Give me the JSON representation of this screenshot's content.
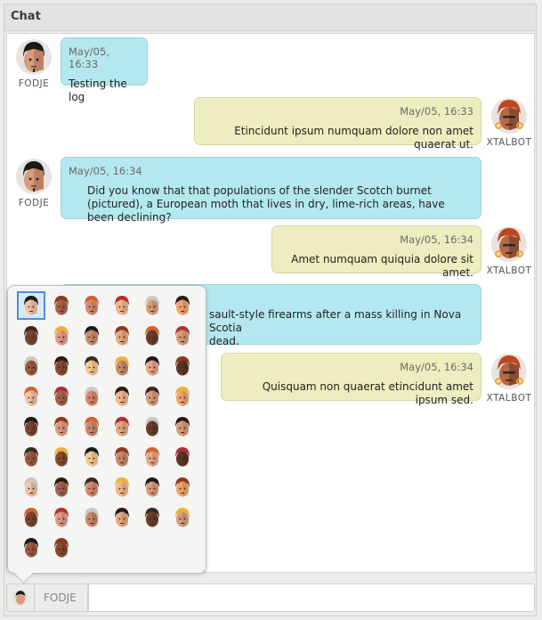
{
  "window": {
    "title": "Chat"
  },
  "messages": [
    {
      "side": "left",
      "user": "FODJE",
      "time": "May/05, 16:33",
      "text": "Testing the log"
    },
    {
      "side": "right",
      "user": "XTALBOT",
      "time": "May/05, 16:33",
      "text": "Etincidunt ipsum numquam dolore non amet quaerat ut."
    },
    {
      "side": "left",
      "user": "FODJE",
      "time": "May/05, 16:34",
      "text": "Did you know that that populations of the slender Scotch burnet (pictured), a European moth that lives in dry, lime-rich areas, have been declining?"
    },
    {
      "side": "right",
      "user": "XTALBOT",
      "time": "May/05, 16:34",
      "text": "Amet numquam quiquia dolore sit amet."
    },
    {
      "side": "left",
      "user": "FODJE",
      "time": "",
      "text": "sault-style firearms after a mass killing in Nova Scotia",
      "text2": "dead."
    },
    {
      "side": "right",
      "user": "XTALBOT",
      "time": "May/05, 16:34",
      "text": "Quisquam non quaerat etincidunt amet ipsum sed."
    }
  ],
  "input": {
    "nickname": "FODJE",
    "placeholder": ""
  },
  "emoji_picker": {
    "selected_index": 0,
    "count": 50
  },
  "colors": {
    "left_bubble": "#b4e8ef",
    "right_bubble": "#ededbf"
  }
}
